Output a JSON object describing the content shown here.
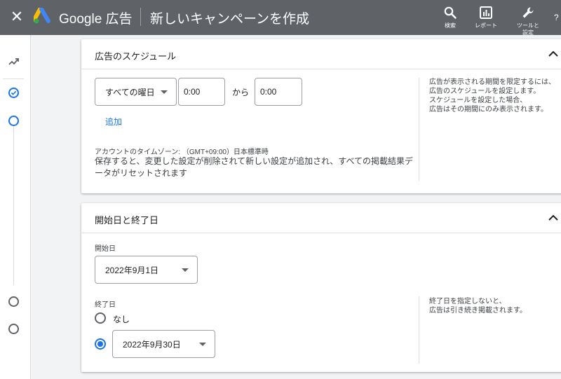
{
  "topbar": {
    "close_icon": "close-icon",
    "brand": "Google 広告",
    "page_title": "新しいキャンペーンを作成",
    "actions": [
      {
        "icon": "search-icon",
        "label": "検索"
      },
      {
        "icon": "report-icon",
        "label": "レポート"
      },
      {
        "icon": "wrench-icon",
        "label": "ツールと\n設定"
      }
    ],
    "colors": {
      "bar": "#5f6368",
      "accent": "#1a73e8"
    }
  },
  "rail": {
    "top_icon": "trend-icon",
    "steps": [
      "done",
      "active",
      "inactive",
      "inactive"
    ]
  },
  "schedule": {
    "title": "広告のスケジュール",
    "day_select": "すべての曜日",
    "start_time": "0:00",
    "separator": "から",
    "end_time": "0:00",
    "add_link": "追加",
    "timezone": "アカウントのタイムゾーン: （GMT+09:00）日本標準時",
    "warning": "保存すると、変更した設定が削除されて新しい設定が追加され、すべての掲載結果データがリセットされます",
    "help": "広告が表示される期間を限定するには、\n広告のスケジュールを設定します。\nスケジュールを設定した場合、\n広告はその期間にのみ表示されます。"
  },
  "dates": {
    "title": "開始日と終了日",
    "start_label": "開始日",
    "start_value": "2022年9月1日",
    "end_label": "終了日",
    "end_none": "なし",
    "end_value": "2022年9月30日",
    "end_selected": "date",
    "help": "終了日を指定しないと、\n広告は引き続き掲載されます。"
  }
}
